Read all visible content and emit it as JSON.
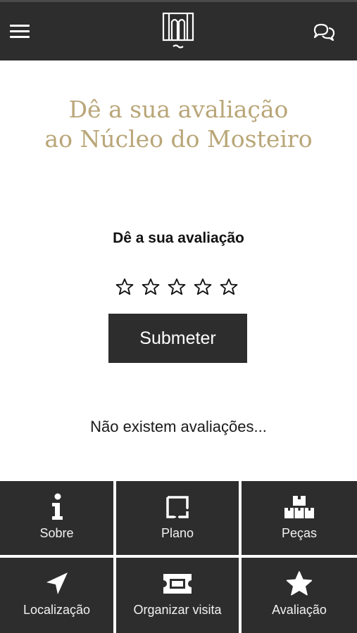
{
  "header": {
    "menu_icon": "hamburger-menu-icon",
    "logo_icon": "monastery-logo-icon",
    "chat_icon": "chat-bubbles-icon"
  },
  "page": {
    "title_line1": "Dê a sua avaliação",
    "title_line2": "ao Núcleo do Mosteiro",
    "title_color": "#b9a678"
  },
  "rating": {
    "heading": "Dê a sua avaliação",
    "stars_total": 5,
    "stars_selected": 0,
    "submit_label": "Submeter",
    "empty_message": "Não existem avaliações..."
  },
  "bottom_nav": {
    "items": [
      {
        "label": "Sobre",
        "icon": "info-icon"
      },
      {
        "label": "Plano",
        "icon": "floor-plan-icon"
      },
      {
        "label": "Peças",
        "icon": "boxes-icon"
      },
      {
        "label": "Localização",
        "icon": "location-arrow-icon"
      },
      {
        "label": "Organizar visita",
        "icon": "ticket-icon"
      },
      {
        "label": "Avaliação",
        "icon": "star-icon"
      }
    ]
  },
  "colors": {
    "bar_background": "#2d2d2d",
    "accent_gold": "#b9a678"
  }
}
